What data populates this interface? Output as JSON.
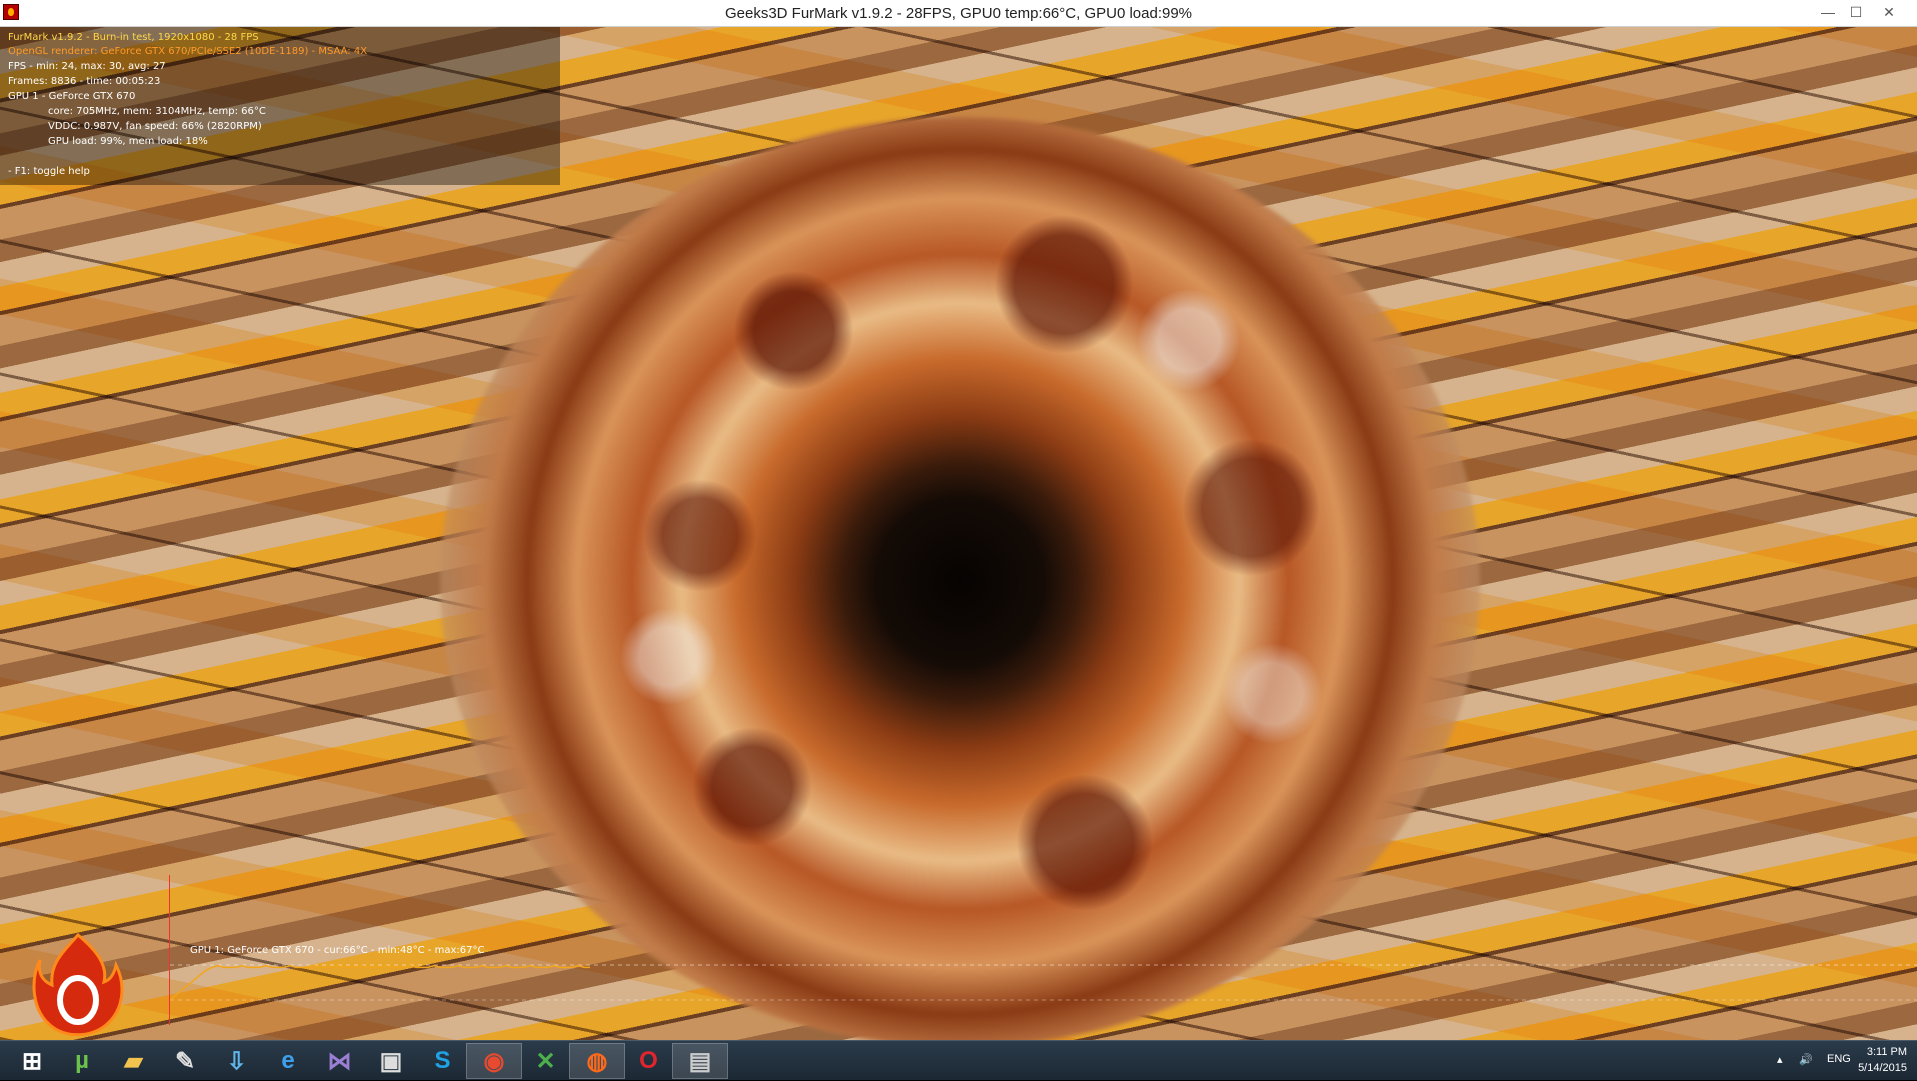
{
  "window": {
    "title": "Geeks3D FurMark v1.9.2 - 28FPS, GPU0 temp:66°C, GPU0 load:99%",
    "icon": "furmark-app-icon",
    "controls": {
      "minimize": "—",
      "maximize": "☐",
      "close": "✕"
    }
  },
  "osd": {
    "line1": "FurMark v1.9.2 - Burn-in test, 1920x1080 - 28 FPS",
    "line2": "OpenGL renderer: GeForce GTX 670/PCIe/SSE2 (10DE-1189) - MSAA: 4X",
    "line3": "FPS - min: 24, max: 30, avg: 27",
    "line4": "Frames: 8836 - time: 00:05:23",
    "line5": "GPU 1 - GeForce GTX 670",
    "line6": "core: 705MHz, mem: 3104MHz, temp: 66°C",
    "line7": "VDDC: 0.987V, fan speed: 66% (2820RPM)",
    "line8": "GPU load: 99%, mem load: 18%",
    "help": "- F1: toggle help"
  },
  "temp_graph": {
    "label": "GPU 1: GeForce GTX 670 - cur:66°C - min:48°C - max:67°C",
    "current_c": 66,
    "min_c": 48,
    "max_c": 67,
    "line_color": "#f3a51a"
  },
  "taskbar": {
    "apps": [
      {
        "name": "start-button",
        "icon": "windows-logo-icon"
      },
      {
        "name": "utorrent",
        "icon": "utorrent-icon"
      },
      {
        "name": "file-explorer",
        "icon": "folder-icon"
      },
      {
        "name": "paint",
        "icon": "paint-icon"
      },
      {
        "name": "downloader",
        "icon": "download-icon"
      },
      {
        "name": "ie-app",
        "icon": "internet-icon"
      },
      {
        "name": "visual-studio",
        "icon": "visual-studio-icon"
      },
      {
        "name": "cpuz",
        "icon": "monitor-icon"
      },
      {
        "name": "skype",
        "icon": "skype-icon"
      },
      {
        "name": "chrome",
        "icon": "chrome-icon"
      },
      {
        "name": "xbox",
        "icon": "xbox-icon"
      },
      {
        "name": "furmark",
        "icon": "furmark-icon"
      },
      {
        "name": "opera",
        "icon": "opera-icon"
      },
      {
        "name": "gpu-tool",
        "icon": "gpu-tool-icon"
      }
    ],
    "language": "ENG",
    "time": "3:11 PM",
    "date": "5/14/2015"
  },
  "colors": {
    "osd_yellow": "#ffd84a",
    "osd_orange": "#ff9a2a",
    "taskbar": "#1c2834"
  }
}
